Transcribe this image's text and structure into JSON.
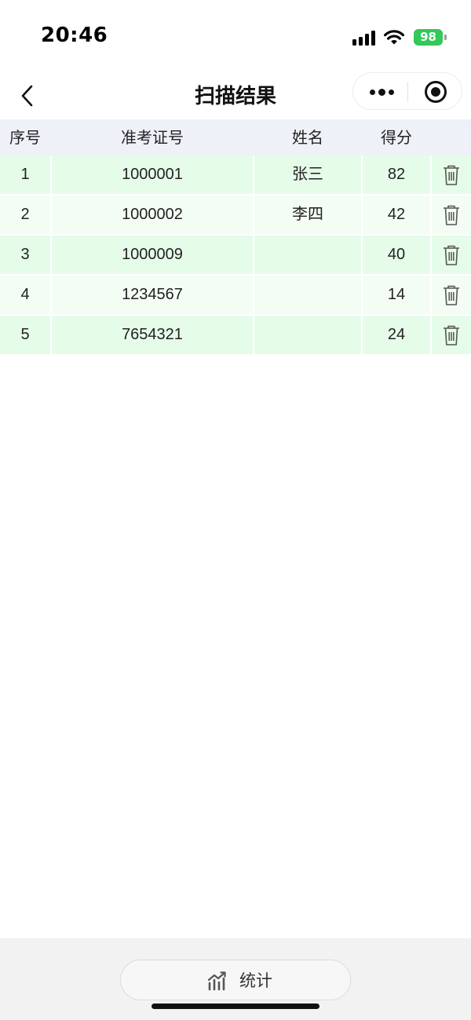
{
  "status_bar": {
    "time": "20:46",
    "battery_level": "98",
    "battery_color": "#34c759"
  },
  "nav": {
    "title": "扫描结果"
  },
  "table": {
    "headers": {
      "seq": "序号",
      "exam_id": "准考证号",
      "name": "姓名",
      "score": "得分"
    },
    "rows": [
      {
        "seq": "1",
        "exam_id": "1000001",
        "name": "张三",
        "score": "82"
      },
      {
        "seq": "2",
        "exam_id": "1000002",
        "name": "李四",
        "score": "42"
      },
      {
        "seq": "3",
        "exam_id": "1000009",
        "name": "",
        "score": "40"
      },
      {
        "seq": "4",
        "exam_id": "1234567",
        "name": "",
        "score": "14"
      },
      {
        "seq": "5",
        "exam_id": "7654321",
        "name": "",
        "score": "24"
      }
    ],
    "row_colors": {
      "odd": "#e5fce9",
      "even": "#f4fdf4",
      "header": "#eef1f8"
    }
  },
  "bottom": {
    "stats_label": "统计",
    "stats_icon": "bar-chart-trend-icon"
  }
}
